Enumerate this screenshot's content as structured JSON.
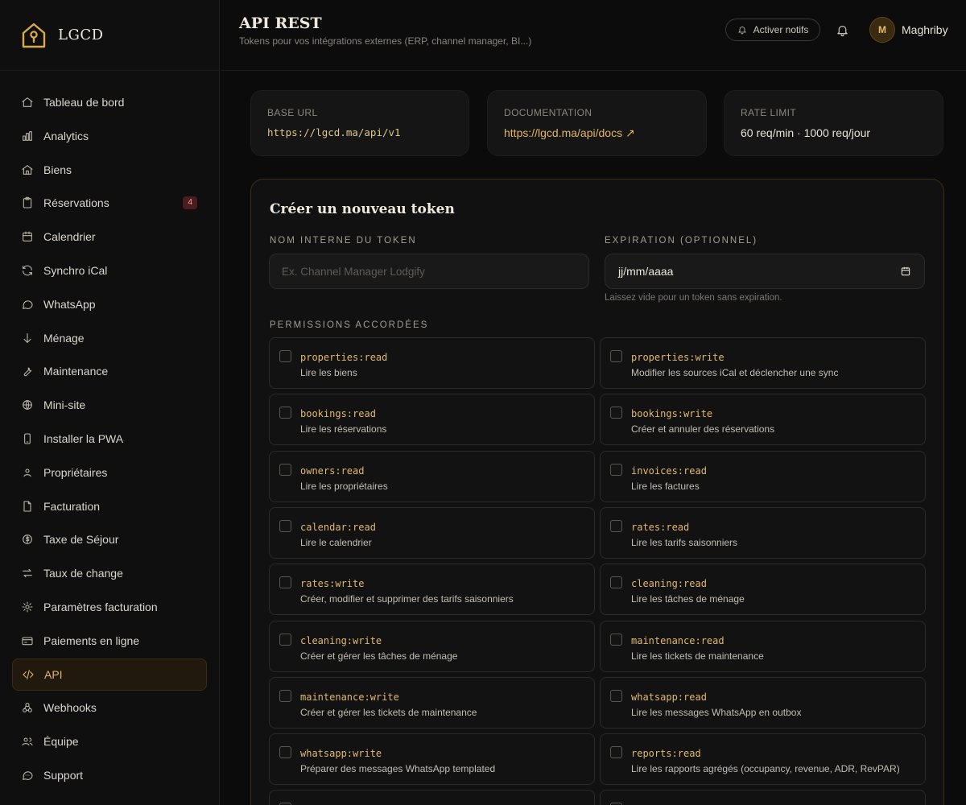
{
  "brand": {
    "name": "LGCD"
  },
  "sidebar": {
    "items": [
      {
        "label": "Tableau de bord",
        "icon": "home-icon"
      },
      {
        "label": "Analytics",
        "icon": "bar-chart-icon"
      },
      {
        "label": "Biens",
        "icon": "house-icon"
      },
      {
        "label": "Réservations",
        "icon": "clipboard-icon",
        "badge": "4"
      },
      {
        "label": "Calendrier",
        "icon": "calendar-icon"
      },
      {
        "label": "Synchro iCal",
        "icon": "sync-icon"
      },
      {
        "label": "WhatsApp",
        "icon": "chat-bubble-icon"
      },
      {
        "label": "Ménage",
        "icon": "arrow-down-icon"
      },
      {
        "label": "Maintenance",
        "icon": "wrench-icon"
      },
      {
        "label": "Mini-site",
        "icon": "globe-icon"
      },
      {
        "label": "Installer la PWA",
        "icon": "smartphone-icon"
      },
      {
        "label": "Propriétaires",
        "icon": "user-icon"
      },
      {
        "label": "Facturation",
        "icon": "file-icon"
      },
      {
        "label": "Taxe de Séjour",
        "icon": "dollar-circle-icon"
      },
      {
        "label": "Taux de change",
        "icon": "exchange-icon"
      },
      {
        "label": "Paramètres facturation",
        "icon": "settings-icon"
      },
      {
        "label": "Paiements en ligne",
        "icon": "credit-card-icon"
      },
      {
        "label": "API",
        "icon": "code-icon",
        "active": true
      },
      {
        "label": "Webhooks",
        "icon": "webhook-icon"
      },
      {
        "label": "Équipe",
        "icon": "users-icon"
      },
      {
        "label": "Support",
        "icon": "support-chat-icon"
      }
    ]
  },
  "header": {
    "title": "API REST",
    "subtitle": "Tokens pour vos intégrations externes (ERP, channel manager, BI...)",
    "notif_button": "Activer notifs",
    "avatar_initial": "M",
    "user_name": "Maghriby"
  },
  "info_cards": {
    "base_url": {
      "label": "BASE URL",
      "value": "https://lgcd.ma/api/v1"
    },
    "documentation": {
      "label": "DOCUMENTATION",
      "value": "https://lgcd.ma/api/docs ↗"
    },
    "rate_limit": {
      "label": "RATE LIMIT",
      "value": "60 req/min · 1000 req/jour"
    }
  },
  "form": {
    "title": "Créer un nouveau token",
    "name_label": "NOM INTERNE DU TOKEN",
    "name_placeholder": "Ex. Channel Manager Lodgify",
    "name_value": "",
    "expiration_label": "EXPIRATION (OPTIONNEL)",
    "expiration_value": "jj/mm/aaaa",
    "expiration_help": "Laissez vide pour un token sans expiration.",
    "permissions_label": "PERMISSIONS ACCORDÉES",
    "permissions": [
      {
        "code": "properties:read",
        "desc": "Lire les biens"
      },
      {
        "code": "properties:write",
        "desc": "Modifier les sources iCal et déclencher une sync"
      },
      {
        "code": "bookings:read",
        "desc": "Lire les réservations"
      },
      {
        "code": "bookings:write",
        "desc": "Créer et annuler des réservations"
      },
      {
        "code": "owners:read",
        "desc": "Lire les propriétaires"
      },
      {
        "code": "invoices:read",
        "desc": "Lire les factures"
      },
      {
        "code": "calendar:read",
        "desc": "Lire le calendrier"
      },
      {
        "code": "rates:read",
        "desc": "Lire les tarifs saisonniers"
      },
      {
        "code": "rates:write",
        "desc": "Créer, modifier et supprimer des tarifs saisonniers"
      },
      {
        "code": "cleaning:read",
        "desc": "Lire les tâches de ménage"
      },
      {
        "code": "cleaning:write",
        "desc": "Créer et gérer les tâches de ménage"
      },
      {
        "code": "maintenance:read",
        "desc": "Lire les tickets de maintenance"
      },
      {
        "code": "maintenance:write",
        "desc": "Créer et gérer les tickets de maintenance"
      },
      {
        "code": "whatsapp:read",
        "desc": "Lire les messages WhatsApp en outbox"
      },
      {
        "code": "whatsapp:write",
        "desc": "Préparer des messages WhatsApp templated"
      },
      {
        "code": "reports:read",
        "desc": "Lire les rapports agrégés (occupancy, revenue, ADR, RevPAR)"
      },
      {
        "code": "",
        "desc": ""
      },
      {
        "code": "",
        "desc": ""
      }
    ]
  },
  "colors": {
    "accent": "#e0b66a",
    "background": "#0b0b0b",
    "badge": "#4a1e1e"
  }
}
